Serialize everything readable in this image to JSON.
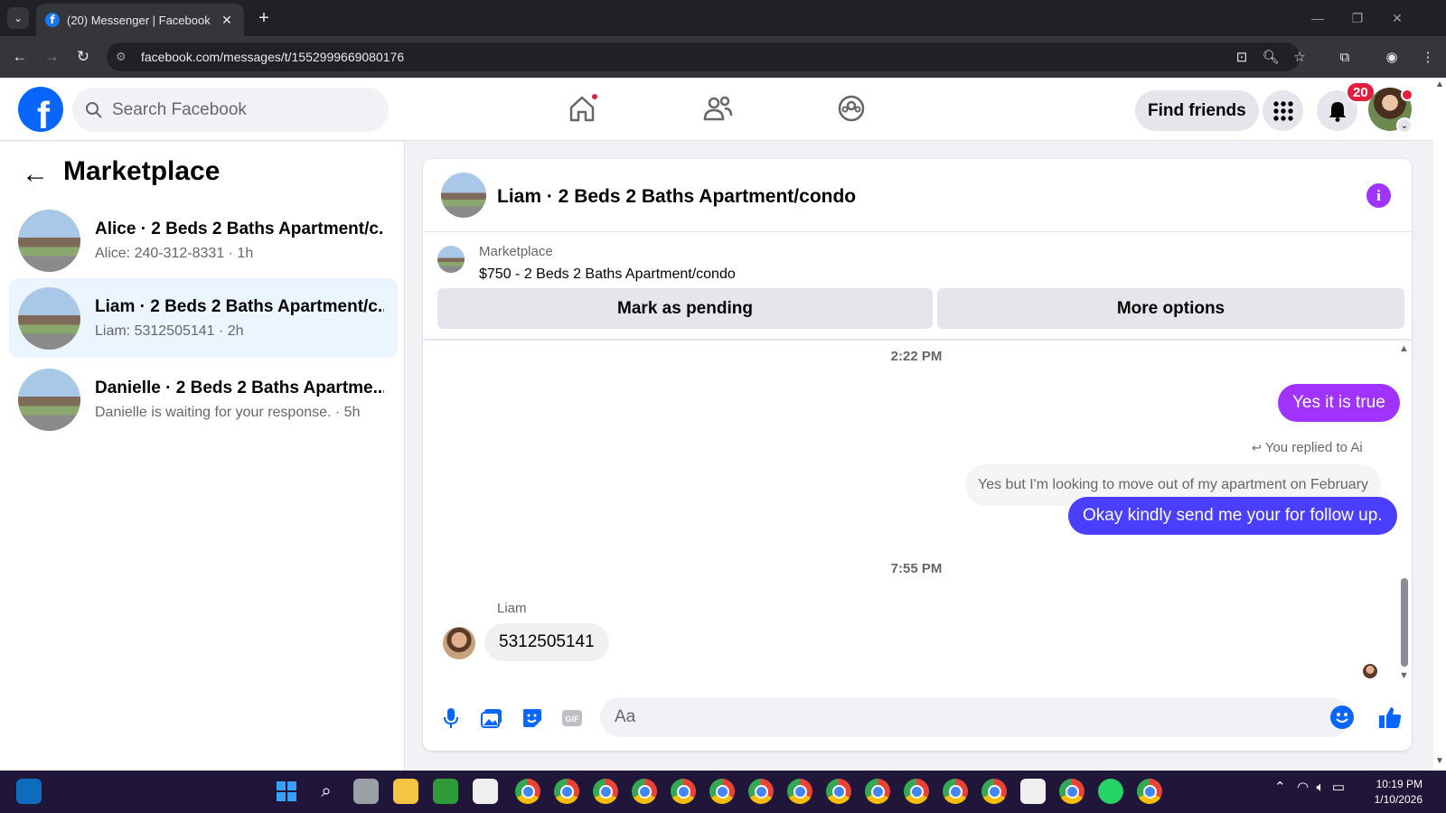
{
  "browser": {
    "tab_title": "(20) Messenger | Facebook",
    "tab_favicon": "f",
    "url": "facebook.com/messages/t/1552999669080176"
  },
  "header": {
    "search_placeholder": "Search Facebook",
    "find_friends": "Find friends",
    "notification_count": "20",
    "logo": "f"
  },
  "chat_list": {
    "title": "Marketplace",
    "items": [
      {
        "name": "Alice · 2 Beds 2 Baths Apartment/c...",
        "snippet": "Alice: 240-312-8331 · 1h",
        "active": false
      },
      {
        "name": "Liam · 2 Beds 2 Baths Apartment/c...",
        "snippet": "Liam: 5312505141 · 2h",
        "active": true
      },
      {
        "name": "Danielle · 2 Beds 2 Baths Apartme...",
        "snippet": "Danielle is waiting for your response. · 5h",
        "active": false
      }
    ]
  },
  "conversation": {
    "title": "Liam · 2 Beds 2 Baths Apartment/condo",
    "marketplace_label": "Marketplace",
    "listing": "$750 - 2 Beds 2 Baths Apartment/condo",
    "mark_pending": "Mark as pending",
    "more_options": "More options",
    "time_1": "2:22 PM",
    "msg_1": "Yes it is true",
    "replied_note": "You replied to Ai",
    "quoted": "Yes but I'm looking to move out of my apartment on February",
    "msg_2": "Okay kindly send me your for follow up.",
    "time_2": "7:55 PM",
    "sender": "Liam",
    "msg_3": "5312505141",
    "composer_placeholder": "Aa"
  },
  "taskbar": {
    "time": "10:19 PM",
    "date": "1/10/2026"
  },
  "colors": {
    "brand_blue": "#0866ff",
    "my_bubble_purple": "#a033ff",
    "my_bubble_blue": "#4a3eff",
    "notif_red": "#e41e3f"
  }
}
